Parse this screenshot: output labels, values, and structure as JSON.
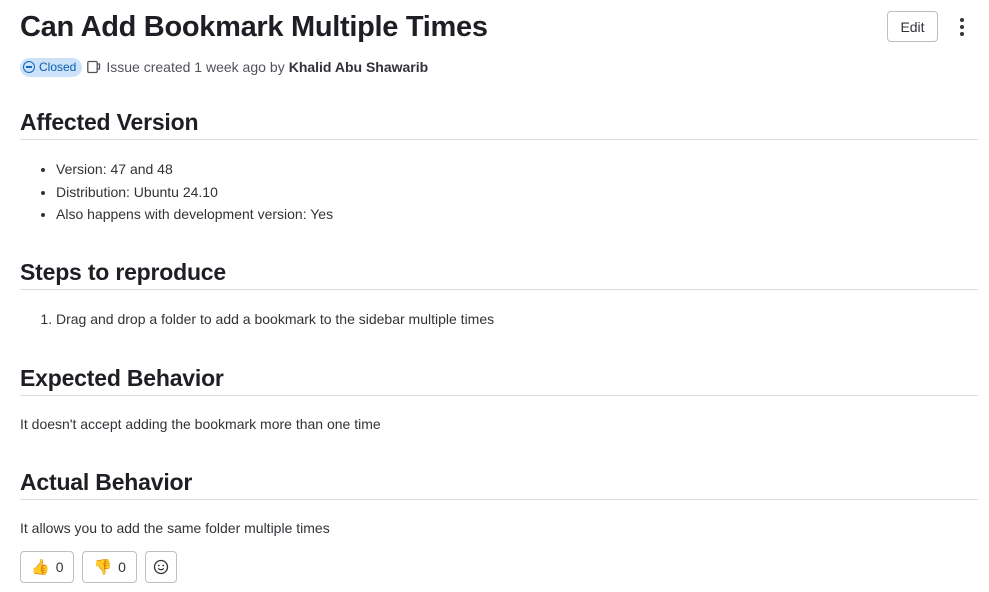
{
  "issue": {
    "title": "Can Add Bookmark Multiple Times",
    "status": "Closed",
    "meta_text": "Issue created 1 week ago",
    "by": "by",
    "author": "Khalid Abu Shawarib"
  },
  "header": {
    "edit_label": "Edit"
  },
  "sections": {
    "affected": {
      "title": "Affected Version",
      "items": [
        "Version: 47 and 48",
        "Distribution: Ubuntu 24.10",
        "Also happens with development version: Yes"
      ]
    },
    "steps": {
      "title": "Steps to reproduce",
      "items": [
        "Drag and drop a folder to add a bookmark to the sidebar multiple times"
      ]
    },
    "expected": {
      "title": "Expected Behavior",
      "text": "It doesn't accept adding the bookmark more than one time"
    },
    "actual": {
      "title": "Actual Behavior",
      "text": "It allows you to add the same folder multiple times"
    }
  },
  "reactions": {
    "thumbs_up": {
      "emoji": "👍",
      "count": "0"
    },
    "thumbs_down": {
      "emoji": "👎",
      "count": "0"
    },
    "add_icon": "smiley-icon"
  },
  "colors": {
    "badge_bg": "#cbe2f9",
    "badge_text": "#0b5cad",
    "text": "#333238"
  }
}
